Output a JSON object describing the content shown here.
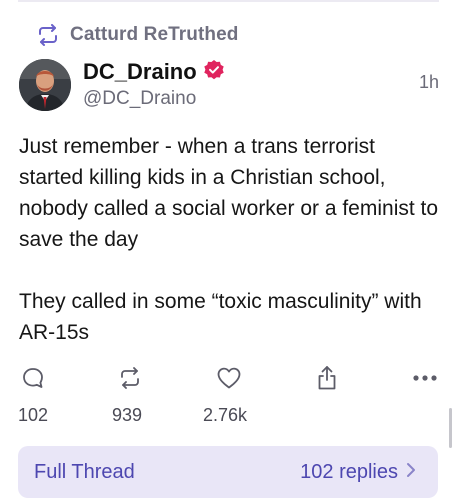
{
  "retruth": {
    "icon": "retruth-icon",
    "label": "Catturd ReTruthed"
  },
  "author": {
    "display_name": "DC_Draino",
    "handle": "@DC_Draino",
    "verified": true,
    "verified_color": "#e0245e",
    "timestamp": "1h"
  },
  "post": {
    "paragraphs": [
      "Just remember - when a trans terrorist started killing kids in a Christian school, nobody called a social worker or a feminist to save the day",
      "They called in some “toxic masculinity” with AR-15s"
    ]
  },
  "actions": {
    "reply": {
      "icon": "reply-icon",
      "count": "102"
    },
    "retruth": {
      "icon": "retruth-icon",
      "count": "939"
    },
    "like": {
      "icon": "heart-icon",
      "count": "2.76k"
    },
    "share": {
      "icon": "share-icon"
    },
    "more": {
      "icon": "more-icon"
    }
  },
  "thread": {
    "label": "Full Thread",
    "replies": "102 replies"
  },
  "colors": {
    "accent": "#4d47b0",
    "thread_bg": "#e9e6f7",
    "muted": "#6b6b78"
  }
}
